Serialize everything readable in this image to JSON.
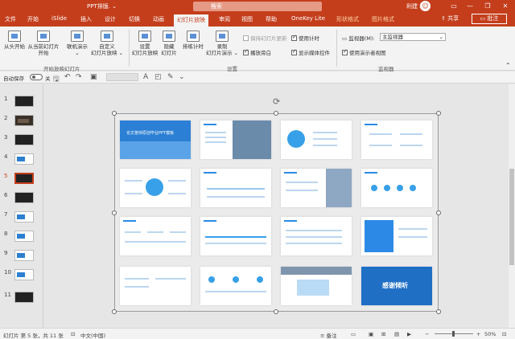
{
  "window": {
    "title": "PPT排版.  ⌄",
    "search_placeholder": "搜索",
    "user_name": "利建 程",
    "avatar_letter": "☺",
    "minimize": "—",
    "restore": "❐",
    "close": "✕"
  },
  "tabs": [
    "文件",
    "开始",
    "iSlide",
    "插入",
    "设计",
    "切换",
    "动画",
    "幻灯片放映",
    "审阅",
    "视图",
    "帮助",
    "OneKey Lite",
    "形状格式",
    "图片格式"
  ],
  "active_tab": "幻灯片放映",
  "share_label": "共享",
  "comment_label": "批注",
  "ribbon": {
    "buttons": [
      {
        "label1": "从头开始",
        "label2": ""
      },
      {
        "label1": "从当前幻灯片",
        "label2": "开始"
      },
      {
        "label1": "联机演示",
        "label2": "⌄"
      },
      {
        "label1": "自定义",
        "label2": "幻灯片放映 ⌄"
      },
      {
        "label1": "设置",
        "label2": "幻灯片放映"
      },
      {
        "label1": "隐藏",
        "label2": "幻灯片"
      },
      {
        "label1": "排练计时",
        "label2": ""
      },
      {
        "label1": "录制",
        "label2": "幻灯片演示 ⌄"
      }
    ],
    "group_start": "开始放映幻灯片",
    "group_setup": "设置",
    "group_monitor": "监视器",
    "checks": [
      {
        "label": "保持幻灯片更新",
        "checked": false,
        "disabled": true
      },
      {
        "label": "使用计时",
        "checked": true,
        "disabled": false
      },
      {
        "label": "播放旁白",
        "checked": true,
        "disabled": false
      },
      {
        "label": "显示媒体控件",
        "checked": true,
        "disabled": false
      }
    ],
    "monitor_label": "监视器(M):",
    "monitor_value": "主监视器",
    "presenter_view": "使用演示者视图"
  },
  "qat": {
    "autosave": "自动保存",
    "autosave_state": "关"
  },
  "thumbnails": [
    "1",
    "2",
    "3",
    "4",
    "5",
    "6",
    "7",
    "8",
    "9",
    "10",
    "11"
  ],
  "active_slide": "5",
  "slides_grid": [
    {
      "title": "论文答辩原创毕业PPT模板",
      "kind": "cover"
    },
    {
      "title": "",
      "kind": "photo"
    },
    {
      "title": "",
      "kind": "circle"
    },
    {
      "title": "",
      "kind": "list"
    },
    {
      "title": "",
      "kind": "mindmap"
    },
    {
      "title": "",
      "kind": "wave"
    },
    {
      "title": "",
      "kind": "img"
    },
    {
      "title": "",
      "kind": "dots"
    },
    {
      "title": "",
      "kind": "cols"
    },
    {
      "title": "",
      "kind": "timeline"
    },
    {
      "title": "",
      "kind": "text"
    },
    {
      "title": "",
      "kind": "bluebox"
    },
    {
      "title": "",
      "kind": "text"
    },
    {
      "title": "",
      "kind": "cards"
    },
    {
      "title": "",
      "kind": "layers"
    },
    {
      "title": "感谢倾听",
      "kind": "end"
    }
  ],
  "status": {
    "slide_info": "幻灯片 第 5 张，共 11 张",
    "language": "中文(中国)",
    "notes": "备注",
    "zoom": "50%"
  }
}
